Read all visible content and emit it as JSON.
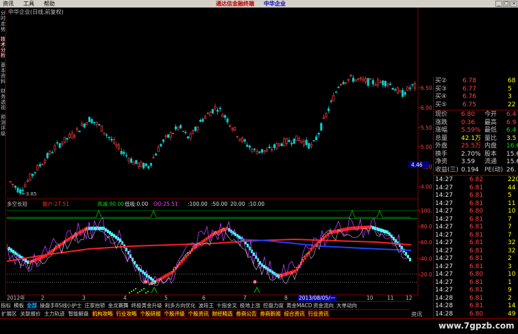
{
  "menubar": {
    "items": [
      "资讯",
      "工具",
      "帮助"
    ],
    "app_name": "通达信金融终端",
    "stock_name": "中华企业"
  },
  "left_tabs": [
    "分时走势",
    "技术分析",
    "基本资料",
    "财务透视",
    "预测评级"
  ],
  "chart": {
    "header": "中华企业(日线,前复权)",
    "low_marker": "3.85",
    "price_axis": [
      "6.50",
      "6.00",
      "5.50",
      "5.00",
      "4.50",
      "4.00"
    ],
    "price_tag": "4.46",
    "indicator_name": "多空长短",
    "indicator_values": [
      {
        "label": "散户:",
        "value": "27.51",
        "color": "#ff3030"
      },
      {
        "label": "高减:",
        "value": "90.00",
        "color": "#00e000"
      },
      {
        "label": "低吸:",
        "value": "0.00",
        "color": "#e0e0e0"
      },
      {
        "label": "OO:",
        "value": "25.51",
        "color": "#ff40ff"
      },
      {
        "label": ":",
        "value": "100.00",
        "color": "#e0e0e0"
      },
      {
        "label": ":",
        "value": "50.00",
        "color": "#e0e0e0"
      },
      {
        "label": "",
        "value": "20.00",
        "color": "#e0e0e0"
      },
      {
        "label": ":",
        "value": "10.00",
        "color": "#e0e0e0"
      }
    ],
    "indicator_axis": [
      "100.00",
      "80.00",
      "60.00",
      "40.00",
      "20.00"
    ],
    "time_labels": [
      "2012年",
      "2",
      "3",
      "4",
      "5",
      "6",
      "7",
      "8",
      "9",
      "2013/08/05/一",
      "10",
      "11",
      "12"
    ]
  },
  "quote": {
    "asks": [
      {
        "label": "买②",
        "price": "6.78",
        "vol": "68"
      },
      {
        "label": "买③",
        "price": "6.77",
        "vol": "5"
      },
      {
        "label": "买④",
        "price": "6.76",
        "vol": "3"
      },
      {
        "label": "买⑤",
        "price": "6.75",
        "vol": "22"
      }
    ],
    "stats": [
      {
        "l1": "现价",
        "v1": "6.80",
        "c1": "red",
        "l2": "今开",
        "v2": "6.4",
        "c2": "red"
      },
      {
        "l1": "涨跌",
        "v1": "0.36",
        "c1": "red",
        "l2": "最高",
        "v2": "6.9",
        "c2": "red"
      },
      {
        "l1": "涨幅",
        "v1": "5.59%",
        "c1": "red",
        "l2": "最低",
        "v2": "6.4",
        "c2": "green"
      },
      {
        "l1": "总量",
        "v1": "42.1万",
        "c1": "yellow",
        "l2": "量比",
        "v2": "3.5",
        "c2": "yellow"
      },
      {
        "l1": "外盘",
        "v1": "25.5万",
        "c1": "red",
        "l2": "内盘",
        "v2": "16.67",
        "c2": "green"
      },
      {
        "l1": "换手",
        "v1": "2.70%",
        "c1": "white",
        "l2": "股本",
        "v2": "15.6",
        "c2": "white"
      },
      {
        "l1": "净资",
        "v1": "3.59",
        "c1": "white",
        "l2": "流通",
        "v2": "15.6",
        "c2": "white"
      },
      {
        "l1": "收益(三)",
        "v1": "0.194",
        "c1": "white",
        "l2": "PE(动)",
        "v2": "26.",
        "c2": "white"
      }
    ],
    "ticks": [
      {
        "time": "14:27",
        "price": "6.82",
        "vol": "220"
      },
      {
        "time": "14:27",
        "price": "6.81",
        "vol": "44"
      },
      {
        "time": "14:27",
        "price": "6.81",
        "vol": "5"
      },
      {
        "time": "14:27",
        "price": "6.81",
        "vol": "11"
      },
      {
        "time": "14:27",
        "price": "6.80",
        "vol": "10"
      },
      {
        "time": "14:27",
        "price": "6.81",
        "vol": "7"
      },
      {
        "time": "14:27",
        "price": "6.81",
        "vol": "7"
      },
      {
        "time": "14:27",
        "price": "6.81",
        "vol": "7"
      },
      {
        "time": "14:27",
        "price": "6.81",
        "vol": "32"
      },
      {
        "time": "14:27",
        "price": "6.81",
        "vol": "32"
      },
      {
        "time": "14:27",
        "price": "6.81",
        "vol": "2"
      },
      {
        "time": "14:27",
        "price": "6.81",
        "vol": "3"
      },
      {
        "time": "14:27",
        "price": "6.80",
        "vol": "10"
      },
      {
        "time": "14:27",
        "price": "6.81",
        "vol": "1"
      },
      {
        "time": "14:27",
        "price": "6.81",
        "vol": "9"
      },
      {
        "time": "14:28",
        "price": "6.81",
        "vol": "2"
      },
      {
        "time": "14:28",
        "price": "6.81",
        "vol": "14"
      },
      {
        "time": "14:28",
        "price": "6.80",
        "vol": "49"
      },
      {
        "time": "14:28",
        "price": "6.80",
        "vol": "44"
      },
      {
        "time": "14:28",
        "price": "6.81",
        "vol": "1"
      }
    ]
  },
  "bottom": {
    "row1": [
      "指标",
      "模板",
      "全部",
      "操盘手BS线",
      "小护士",
      "庄家抬轿",
      "金龙赛舞",
      "终极黄金升级",
      "利多方向优化",
      "波段王",
      "十指金叉",
      "极地上涨",
      "控盘力度",
      "黄金MACD",
      "资金流向",
      "大单动向"
    ],
    "row2": [
      "扩展区",
      "关联报价",
      "主力轨迹",
      "智能解盘",
      "机构攻略",
      "行业攻略",
      "个股研报",
      "个股评级",
      "个股资讯",
      "财经精选",
      "券商公告",
      "券商新闻",
      "综合资讯",
      "行业资讯"
    ],
    "corner": "资讯",
    "watermark": "www.7gpzb.com"
  }
}
